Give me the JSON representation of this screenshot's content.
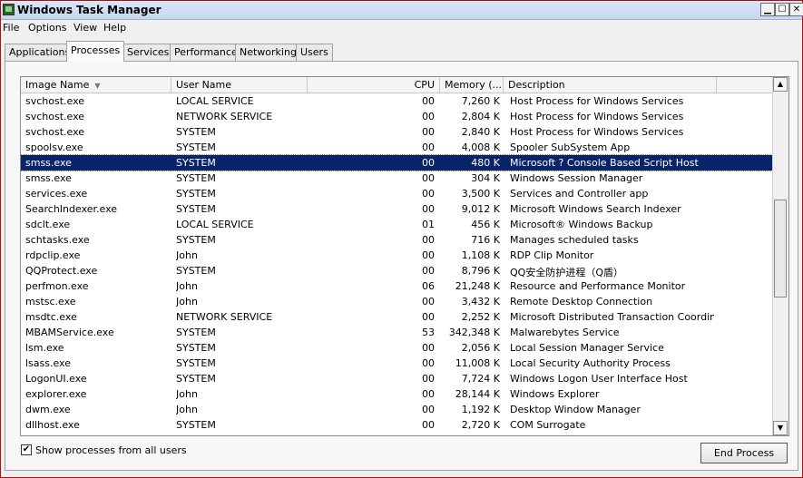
{
  "window": {
    "title": "Windows Task Manager",
    "min_glyph": "▁",
    "max_glyph": "☐",
    "close_glyph": "✕"
  },
  "menu": [
    "File",
    "Options",
    "View",
    "Help"
  ],
  "tabs": [
    {
      "label": "Applications",
      "active": false
    },
    {
      "label": "Processes",
      "active": true
    },
    {
      "label": "Services",
      "active": false
    },
    {
      "label": "Performance",
      "active": false
    },
    {
      "label": "Networking",
      "active": false
    },
    {
      "label": "Users",
      "active": false
    }
  ],
  "columns": {
    "image": "Image Name",
    "user": "User Name",
    "cpu": "CPU",
    "memory": "Memory (...",
    "description": "Description",
    "sort_glyph": "▼"
  },
  "rows": [
    {
      "image": "svchost.exe",
      "user": "LOCAL SERVICE",
      "cpu": "00",
      "memory": "7,260 K",
      "description": "Host Process for Windows Services"
    },
    {
      "image": "svchost.exe",
      "user": "NETWORK SERVICE",
      "cpu": "00",
      "memory": "2,804 K",
      "description": "Host Process for Windows Services"
    },
    {
      "image": "svchost.exe",
      "user": "SYSTEM",
      "cpu": "00",
      "memory": "2,840 K",
      "description": "Host Process for Windows Services"
    },
    {
      "image": "spoolsv.exe",
      "user": "SYSTEM",
      "cpu": "00",
      "memory": "4,008 K",
      "description": "Spooler SubSystem App"
    },
    {
      "image": "smss.exe",
      "user": "SYSTEM",
      "cpu": "00",
      "memory": "480 K",
      "description": "Microsoft ? Console Based Script Host",
      "selected": true
    },
    {
      "image": "smss.exe",
      "user": "SYSTEM",
      "cpu": "00",
      "memory": "304 K",
      "description": "Windows Session Manager"
    },
    {
      "image": "services.exe",
      "user": "SYSTEM",
      "cpu": "00",
      "memory": "3,500 K",
      "description": "Services and Controller app"
    },
    {
      "image": "SearchIndexer.exe",
      "user": "SYSTEM",
      "cpu": "00",
      "memory": "9,012 K",
      "description": "Microsoft Windows Search Indexer"
    },
    {
      "image": "sdclt.exe",
      "user": "LOCAL SERVICE",
      "cpu": "01",
      "memory": "456 K",
      "description": "Microsoft® Windows Backup"
    },
    {
      "image": "schtasks.exe",
      "user": "SYSTEM",
      "cpu": "00",
      "memory": "716 K",
      "description": "Manages scheduled tasks"
    },
    {
      "image": "rdpclip.exe",
      "user": "John",
      "cpu": "00",
      "memory": "1,108 K",
      "description": "RDP Clip Monitor"
    },
    {
      "image": "QQProtect.exe",
      "user": "SYSTEM",
      "cpu": "00",
      "memory": "8,796 K",
      "description": "QQ安全防护进程（Q盾）"
    },
    {
      "image": "perfmon.exe",
      "user": "John",
      "cpu": "06",
      "memory": "21,248 K",
      "description": "Resource and Performance Monitor"
    },
    {
      "image": "mstsc.exe",
      "user": "John",
      "cpu": "00",
      "memory": "3,432 K",
      "description": "Remote Desktop Connection"
    },
    {
      "image": "msdtc.exe",
      "user": "NETWORK SERVICE",
      "cpu": "00",
      "memory": "2,252 K",
      "description": "Microsoft Distributed Transaction Coordinat..."
    },
    {
      "image": "MBAMService.exe",
      "user": "SYSTEM",
      "cpu": "53",
      "memory": "342,348 K",
      "description": "Malwarebytes Service"
    },
    {
      "image": "lsm.exe",
      "user": "SYSTEM",
      "cpu": "00",
      "memory": "2,056 K",
      "description": "Local Session Manager Service"
    },
    {
      "image": "lsass.exe",
      "user": "SYSTEM",
      "cpu": "00",
      "memory": "11,008 K",
      "description": "Local Security Authority Process"
    },
    {
      "image": "LogonUI.exe",
      "user": "SYSTEM",
      "cpu": "00",
      "memory": "7,724 K",
      "description": "Windows Logon User Interface Host"
    },
    {
      "image": "explorer.exe",
      "user": "John",
      "cpu": "00",
      "memory": "28,144 K",
      "description": "Windows Explorer"
    },
    {
      "image": "dwm.exe",
      "user": "John",
      "cpu": "00",
      "memory": "1,192 K",
      "description": "Desktop Window Manager"
    },
    {
      "image": "dllhost.exe",
      "user": "SYSTEM",
      "cpu": "00",
      "memory": "2,720 K",
      "description": "COM Surrogate"
    }
  ],
  "scrollbar": {
    "up_glyph": "▲",
    "down_glyph": "▼"
  },
  "show_all": {
    "label": "Show processes from all users",
    "checked": true,
    "check_glyph": "✔"
  },
  "end_process_label": "End Process",
  "colors": {
    "selection": "#0a246a",
    "frame": "#a31515"
  }
}
